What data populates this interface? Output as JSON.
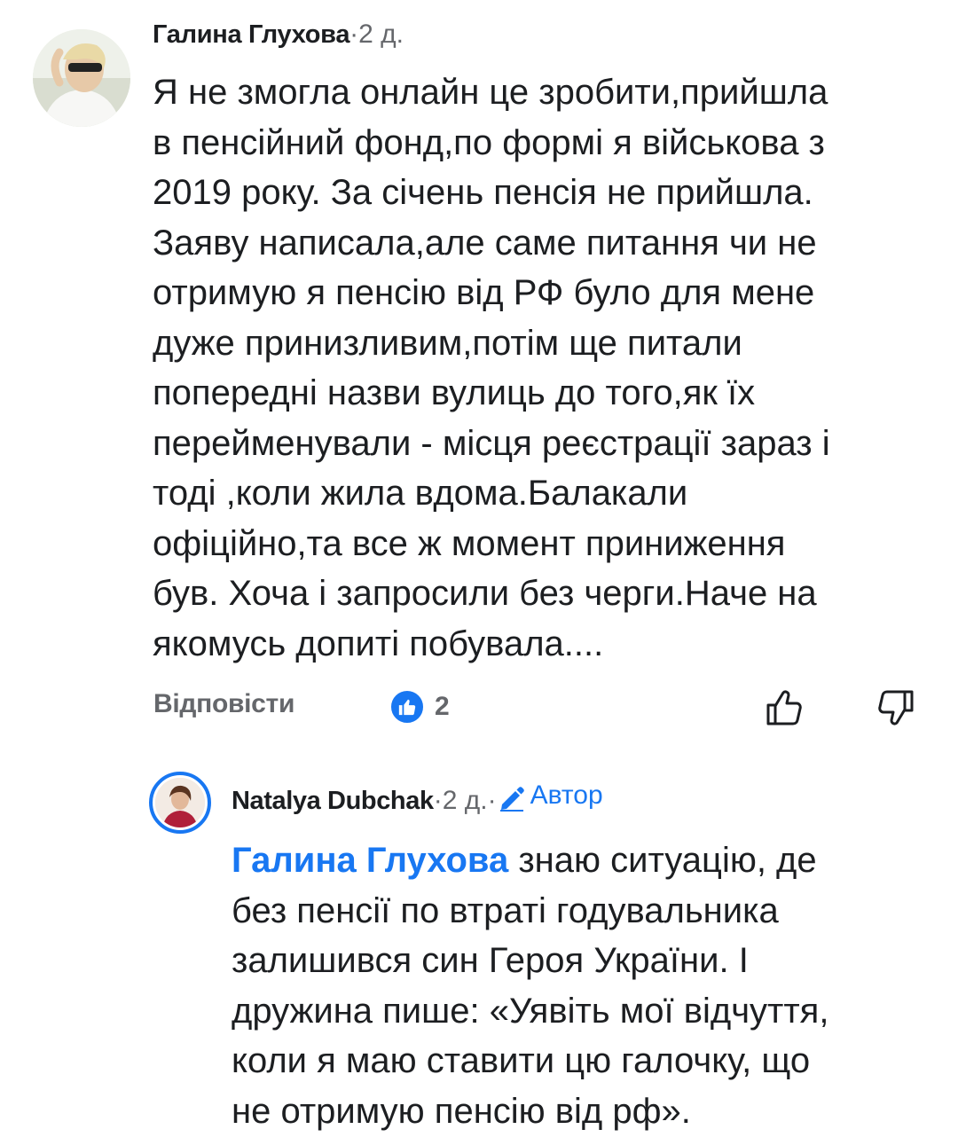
{
  "comment1": {
    "author": "Галина Глухова",
    "separator": " · ",
    "time": "2 д.",
    "text": "Я не змогла онлайн це зробити,прийшла\nв пенсійний фонд,по формі я військова з\n2019 року. За січень пенсія не прийшла.\nЗаяву написала,але саме питання чи не\nотримую я пенсію від РФ було для мене\nдуже принизливим,потім ще питали\nпопередні назви вулиць до того,як їх\nперейменували - місця реєстрації зараз і\nтоді ,коли жила вдома.Балакали\nофіційно,та все ж момент приниження\nбув. Хоча і запросили без черги.Наче на\nякомусь допиті побувала....",
    "reply_label": "Відповісти",
    "reaction_count": "2",
    "avatar_icon": "user-photo-avatar"
  },
  "comment2": {
    "author": "Natalya Dubchak",
    "separator": " · ",
    "time": "2 д.",
    "separator2": " · ",
    "author_badge": "Автор",
    "mention": "Галина Глухова",
    "text": " знаю ситуацію, де\nбез пенсії по втраті годувальника\nзалишився син Героя України. І\nдружина пише: «Уявіть мої відчуття,\nколи я маю ставити цю галочку, що\nне отримую пенсію від рф».",
    "avatar_icon": "user-photo-avatar"
  },
  "icons": {
    "like": "like-thumb-icon",
    "thumb_up": "thumb-up-outline-icon",
    "thumb_down": "thumb-down-outline-icon",
    "pencil": "pencil-icon"
  },
  "colors": {
    "accent": "#1877f2",
    "text": "#1c1e21",
    "muted": "#65676b"
  }
}
